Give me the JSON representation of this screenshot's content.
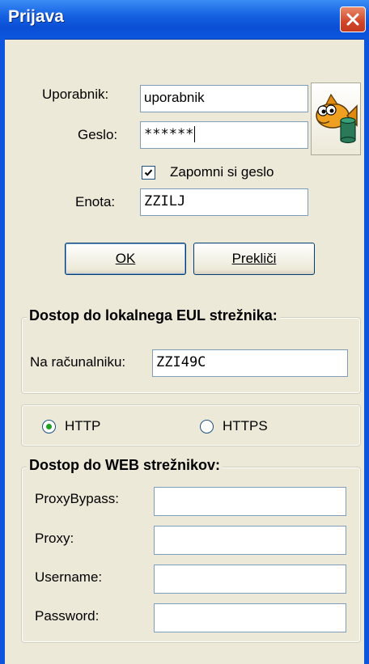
{
  "window": {
    "title": "Prijava"
  },
  "login": {
    "user_label": "Uporabnik:",
    "user_value": "uporabnik",
    "password_label": "Geslo:",
    "password_value": "******",
    "remember_label": "Zapomni si geslo",
    "remember_checked": true,
    "unit_label": "Enota:",
    "unit_value": "ZZILJ"
  },
  "buttons": {
    "ok": "OK",
    "cancel": "Prekliči"
  },
  "local_server": {
    "title": "Dostop do lokalnega EUL strežnika:",
    "computer_label": "Na računalniku:",
    "computer_value": "ZZI49C"
  },
  "protocol": {
    "http_label": "HTTP",
    "https_label": "HTTPS",
    "selected": "HTTP"
  },
  "web_servers": {
    "title": "Dostop do WEB strežnikov:",
    "proxy_bypass_label": "ProxyBypass:",
    "proxy_bypass_value": "",
    "proxy_label": "Proxy:",
    "proxy_value": "",
    "username_label": "Username:",
    "username_value": "",
    "password_label": "Password:",
    "password_value": ""
  },
  "icons": {
    "logo": "fish-database-icon",
    "close": "close-icon"
  }
}
